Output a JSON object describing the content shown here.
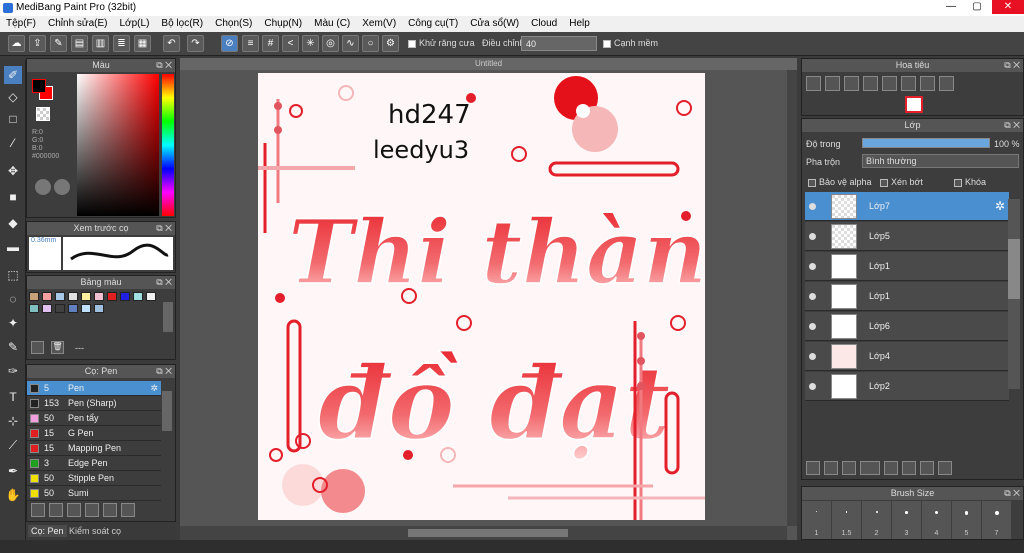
{
  "window": {
    "title": "MediBang Paint Pro (32bit)",
    "min": "—",
    "max": "▢",
    "close": "✕"
  },
  "menu": [
    "Tệp(F)",
    "Chỉnh sửa(E)",
    "Lớp(L)",
    "Bộ lọc(R)",
    "Chọn(S)",
    "Chụp(N)",
    "Màu (C)",
    "Xem(V)",
    "Công cụ(T)",
    "Cửa sổ(W)",
    "Cloud",
    "Help"
  ],
  "toolbar": {
    "antialias": "Khử răng cưa",
    "adjust_label": "Điều chỉnh",
    "adjust_value": "40",
    "smooth": "Cạnh mềm",
    "tab": "Untitled"
  },
  "color_panel": {
    "title": "Màu",
    "r": "R:0",
    "g": "G:0",
    "b": "B:0",
    "hex": "#000000",
    "primary": "#000000",
    "secondary": "#ff0000"
  },
  "brush_preview": {
    "title": "Xem trước cọ",
    "size": "0.36mm"
  },
  "palette": {
    "title": "Bảng màu",
    "name": "---",
    "colors": [
      "#c8a07a",
      "#f4a0a0",
      "#a8c8e8",
      "#e0e0e0",
      "#fff0a0",
      "#f0c0d0",
      "#e02020",
      "#2020e0",
      "#a0e0e0",
      "#f0f0f0",
      "#80c0c0",
      "#e0c0f0",
      "#404040",
      "#6080c0",
      "#c0e0ff",
      "#a0c0e0"
    ]
  },
  "brush_panel": {
    "title": "Cọ: Pen",
    "items": [
      {
        "size": "5",
        "name": "Pen",
        "color": "#222222"
      },
      {
        "size": "153",
        "name": "Pen (Sharp)",
        "color": "#222222"
      },
      {
        "size": "50",
        "name": "Pen tẩy",
        "color": "#f0a0e0"
      },
      {
        "size": "15",
        "name": "G Pen",
        "color": "#e02020"
      },
      {
        "size": "15",
        "name": "Mapping Pen",
        "color": "#e02020"
      },
      {
        "size": "3",
        "name": "Edge Pen",
        "color": "#20a020"
      },
      {
        "size": "50",
        "name": "Stipple Pen",
        "color": "#f0e000"
      },
      {
        "size": "50",
        "name": "Sumi",
        "color": "#f0e000"
      }
    ],
    "tab1": "Cọ: Pen",
    "tab2": "Kiểm soát cọ"
  },
  "canvas": {
    "tab": "Untitled",
    "text1": "Thi thành",
    "text2": "đồ đạt",
    "note1": "hd247",
    "note2": "leedyu3"
  },
  "navigator": {
    "title": "Hoa tiêu"
  },
  "layers": {
    "title": "Lớp",
    "opacity_label": "Độ trong",
    "opacity_value": "100 %",
    "opacity": 1.0,
    "blend_label": "Pha trộn",
    "blend_value": "Bình thường",
    "protect_alpha": "Bảo vệ alpha",
    "clipping": "Xén bớt",
    "lock": "Khóa",
    "items": [
      {
        "name": "Lớp7"
      },
      {
        "name": "Lớp5"
      },
      {
        "name": "Lớp1"
      },
      {
        "name": "Lớp1"
      },
      {
        "name": "Lớp6"
      },
      {
        "name": "Lớp4"
      },
      {
        "name": "Lớp2"
      }
    ]
  },
  "brush_size": {
    "title": "Brush Size",
    "values": [
      "1",
      "1.5",
      "2",
      "3",
      "4",
      "5",
      "7"
    ]
  }
}
